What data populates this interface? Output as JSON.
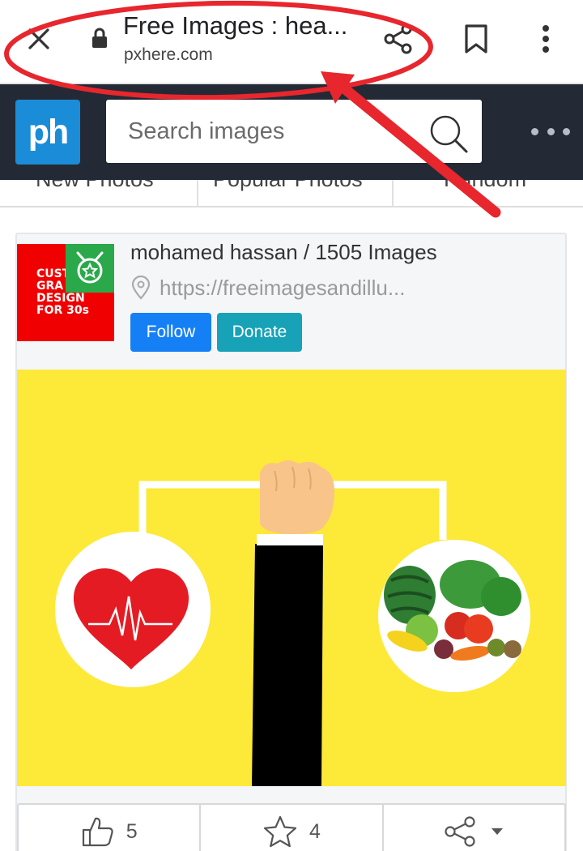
{
  "browser": {
    "title": "Free Images : hea...",
    "domain": "pxhere.com"
  },
  "site": {
    "logo": "ph",
    "search_placeholder": "Search images"
  },
  "nav": {
    "tabs": [
      "New Photos",
      "Popular Photos",
      "Random"
    ]
  },
  "author": {
    "line": "mohamed hassan / 1505 Images",
    "link": "https://freeimagesandillu...",
    "avatar_lines": [
      "CUST",
      "GRA",
      "DESIGN",
      "FOR 30s"
    ],
    "follow_label": "Follow",
    "donate_label": "Donate"
  },
  "stats": {
    "likes": "5",
    "favorites": "4"
  },
  "icons": {
    "close": "close-icon",
    "lock": "lock-icon",
    "share": "share-icon",
    "bookmark": "bookmark-icon",
    "menu": "more-vert-icon",
    "search": "search-icon",
    "location": "location-pin-icon",
    "like": "thumbs-up-icon",
    "favorite": "star-icon"
  },
  "colors": {
    "header_bg": "#232a35",
    "logo_bg": "#1a8cd8",
    "follow_bg": "#1580f5",
    "donate_bg": "#17a2b8",
    "photo_bg": "#fde938",
    "annotation": "#e8262d"
  }
}
